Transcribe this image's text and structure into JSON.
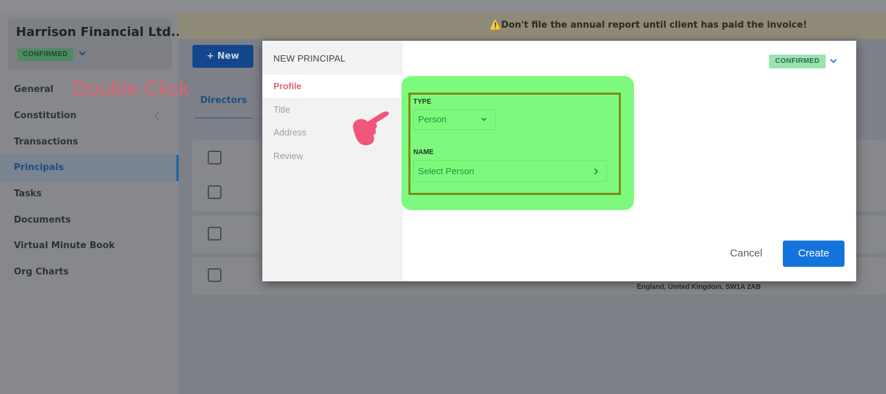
{
  "company": {
    "name": "Harrison Financial Ltd...",
    "status": "CONFIRMED"
  },
  "sidebar": {
    "items": [
      {
        "label": "General"
      },
      {
        "label": "Constitution"
      },
      {
        "label": "Transactions"
      },
      {
        "label": "Principals",
        "active": true
      },
      {
        "label": "Tasks"
      },
      {
        "label": "Documents"
      },
      {
        "label": "Virtual Minute Book"
      },
      {
        "label": "Org Charts"
      }
    ]
  },
  "banner": {
    "text": "⚠️Don't file the annual report until client has paid the invoice!"
  },
  "toolbar": {
    "new_label": "New"
  },
  "tabs": {
    "directors": "Directors"
  },
  "rows": {
    "address": "England, United Kingdom, SW1A 2AB"
  },
  "annotation": {
    "text": "Double Click"
  },
  "modal": {
    "title": "NEW PRINCIPAL",
    "status": "CONFIRMED",
    "steps": [
      {
        "label": "Profile",
        "active": true
      },
      {
        "label": "Title"
      },
      {
        "label": "Address"
      },
      {
        "label": "Review"
      }
    ],
    "type_label": "TYPE",
    "type_value": "Person",
    "name_label": "NAME",
    "name_placeholder": "Select Person",
    "cancel_label": "Cancel",
    "create_label": "Create"
  },
  "colors": {
    "accent": "#1574dc",
    "highlight": "#7dfa7d",
    "annotation": "#e0636f",
    "confirmed_badge": "#9be3b3"
  }
}
